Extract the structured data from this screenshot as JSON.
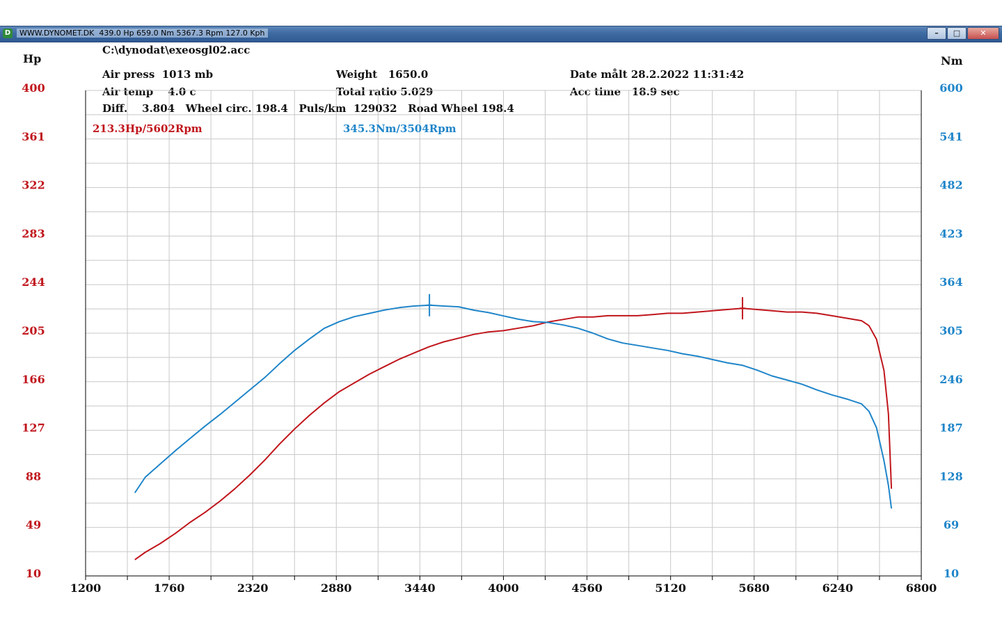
{
  "window": {
    "title": "WWW.DYNOMET.DK  439.0 Hp 659.0 Nm 5367.3 Rpm 127.0 Kph",
    "icon": "dynomet-app-icon",
    "buttons": [
      "minimize-icon",
      "maximize-icon",
      "close-icon"
    ]
  },
  "header": {
    "file": "C:\\dynodat\\exeosgl02.acc",
    "air_press": "Air press  1013 mb",
    "air_temp": "Air temp    4.0 c",
    "diff": "Diff.    3.804   Wheel circ. 198.4   Puls/km  129032   Road Wheel 198.4",
    "weight": "Weight   1650.0",
    "total_ratio": "Total ratio 5.029",
    "date": "Date målt 28.2.2022 11:31:42",
    "acc_time": "Acc time   18.9 sec"
  },
  "colors": {
    "power": "#c0161c",
    "torque": "#1f85c9",
    "grid": "#c8c8c8",
    "axis": "#000000"
  },
  "chart_data": {
    "type": "line",
    "xlim": [
      1200,
      6800
    ],
    "x_ticks": [
      1200,
      1760,
      2320,
      2880,
      3440,
      4000,
      4560,
      5120,
      5680,
      6240,
      6800
    ],
    "y_left": {
      "label": "Hp",
      "ticks": [
        10,
        49,
        88,
        127,
        166,
        205,
        244,
        283,
        322,
        361,
        400
      ],
      "lim": [
        10,
        400
      ]
    },
    "y_right": {
      "label": "Nm",
      "ticks": [
        10,
        69,
        128,
        187,
        246,
        305,
        364,
        423,
        482,
        541,
        600
      ],
      "lim": [
        10,
        600
      ]
    },
    "grid": true,
    "series": [
      {
        "axis": "left",
        "peak_label": "213.3Hp/5602Rpm",
        "peak": [
          5602,
          213.3
        ],
        "points": [
          [
            1530,
            23
          ],
          [
            1600,
            29
          ],
          [
            1700,
            36
          ],
          [
            1800,
            44
          ],
          [
            1900,
            53
          ],
          [
            2000,
            61
          ],
          [
            2100,
            70
          ],
          [
            2200,
            80
          ],
          [
            2300,
            91
          ],
          [
            2400,
            103
          ],
          [
            2500,
            116
          ],
          [
            2600,
            128
          ],
          [
            2700,
            139
          ],
          [
            2800,
            149
          ],
          [
            2900,
            158
          ],
          [
            3000,
            165
          ],
          [
            3100,
            172
          ],
          [
            3200,
            178
          ],
          [
            3300,
            184
          ],
          [
            3400,
            189
          ],
          [
            3500,
            194
          ],
          [
            3600,
            198
          ],
          [
            3700,
            201
          ],
          [
            3800,
            204
          ],
          [
            3900,
            206
          ],
          [
            4000,
            207
          ],
          [
            4100,
            209
          ],
          [
            4200,
            211
          ],
          [
            4300,
            214
          ],
          [
            4400,
            216
          ],
          [
            4500,
            218
          ],
          [
            4600,
            218
          ],
          [
            4700,
            219
          ],
          [
            4800,
            219
          ],
          [
            4900,
            219
          ],
          [
            5000,
            220
          ],
          [
            5100,
            221
          ],
          [
            5200,
            221
          ],
          [
            5300,
            222
          ],
          [
            5400,
            223
          ],
          [
            5500,
            224
          ],
          [
            5602,
            225
          ],
          [
            5700,
            224
          ],
          [
            5800,
            223
          ],
          [
            5900,
            222
          ],
          [
            6000,
            222
          ],
          [
            6100,
            221
          ],
          [
            6200,
            219
          ],
          [
            6300,
            217
          ],
          [
            6400,
            215
          ],
          [
            6450,
            211
          ],
          [
            6500,
            200
          ],
          [
            6550,
            175
          ],
          [
            6580,
            140
          ],
          [
            6600,
            80
          ]
        ]
      },
      {
        "axis": "right",
        "peak_label": "345.3Nm/3504Rpm",
        "peak": [
          3504,
          345.3
        ],
        "points": [
          [
            1530,
            111
          ],
          [
            1600,
            130
          ],
          [
            1700,
            146
          ],
          [
            1800,
            162
          ],
          [
            1900,
            177
          ],
          [
            2000,
            192
          ],
          [
            2100,
            206
          ],
          [
            2200,
            221
          ],
          [
            2300,
            236
          ],
          [
            2400,
            251
          ],
          [
            2500,
            268
          ],
          [
            2600,
            284
          ],
          [
            2700,
            298
          ],
          [
            2800,
            311
          ],
          [
            2900,
            319
          ],
          [
            3000,
            325
          ],
          [
            3100,
            329
          ],
          [
            3200,
            333
          ],
          [
            3300,
            336
          ],
          [
            3400,
            338
          ],
          [
            3504,
            339
          ],
          [
            3600,
            338
          ],
          [
            3700,
            337
          ],
          [
            3800,
            333
          ],
          [
            3900,
            330
          ],
          [
            4000,
            326
          ],
          [
            4100,
            322
          ],
          [
            4200,
            319
          ],
          [
            4300,
            318
          ],
          [
            4400,
            315
          ],
          [
            4500,
            311
          ],
          [
            4600,
            305
          ],
          [
            4700,
            298
          ],
          [
            4800,
            293
          ],
          [
            4900,
            290
          ],
          [
            5000,
            287
          ],
          [
            5100,
            284
          ],
          [
            5200,
            280
          ],
          [
            5300,
            277
          ],
          [
            5400,
            273
          ],
          [
            5500,
            269
          ],
          [
            5600,
            266
          ],
          [
            5700,
            260
          ],
          [
            5800,
            253
          ],
          [
            5900,
            248
          ],
          [
            6000,
            243
          ],
          [
            6100,
            236
          ],
          [
            6200,
            230
          ],
          [
            6300,
            225
          ],
          [
            6400,
            219
          ],
          [
            6450,
            210
          ],
          [
            6500,
            190
          ],
          [
            6550,
            150
          ],
          [
            6580,
            120
          ],
          [
            6600,
            92
          ]
        ]
      }
    ]
  }
}
